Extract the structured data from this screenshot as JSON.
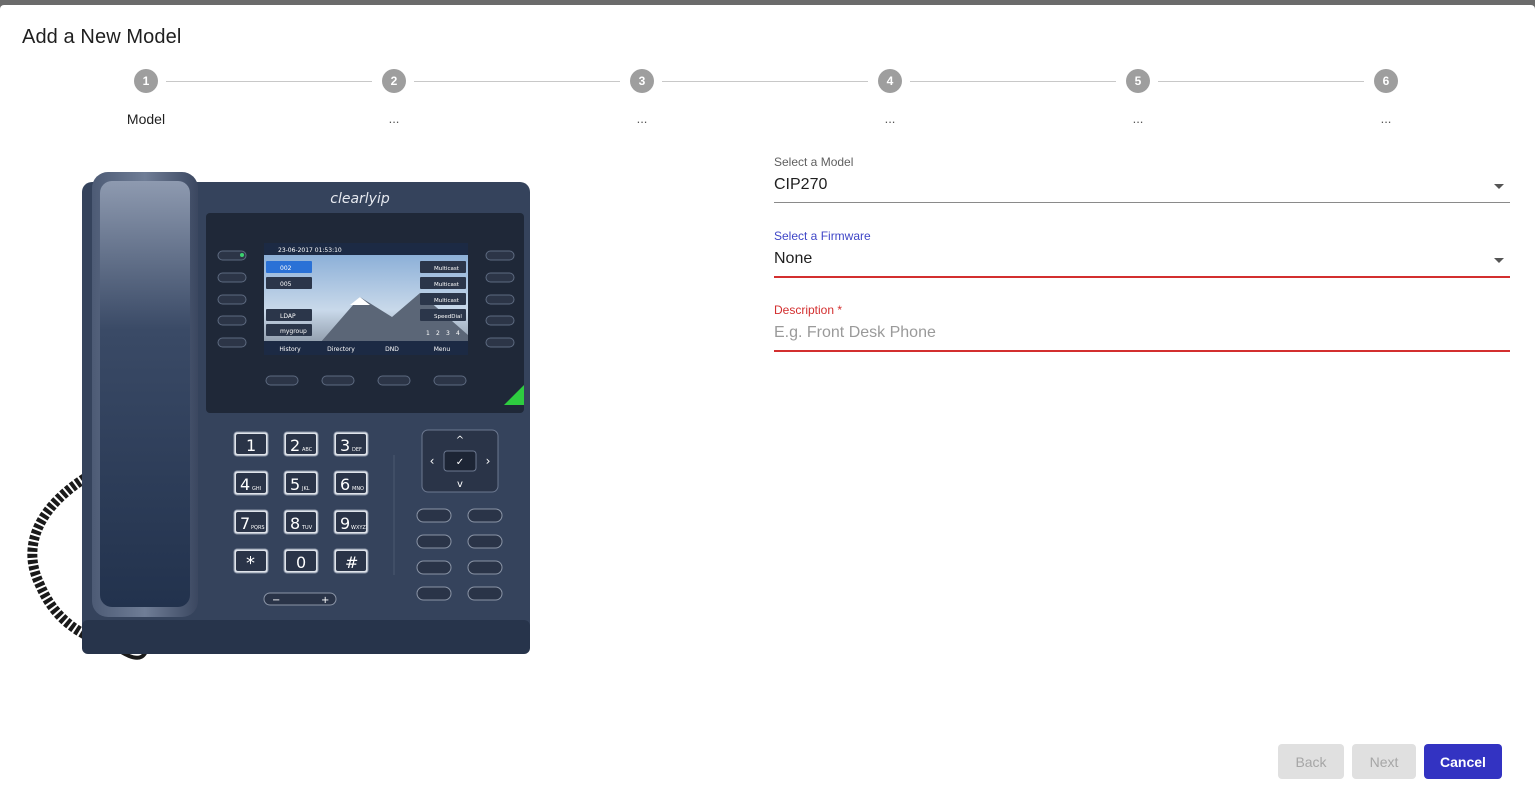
{
  "dialog": {
    "title": "Add a New Model"
  },
  "stepper": {
    "steps": [
      {
        "number": "1",
        "label": "Model"
      },
      {
        "number": "2",
        "label": "..."
      },
      {
        "number": "3",
        "label": "..."
      },
      {
        "number": "4",
        "label": "..."
      },
      {
        "number": "5",
        "label": "..."
      },
      {
        "number": "6",
        "label": "..."
      }
    ]
  },
  "form": {
    "model": {
      "label": "Select a Model",
      "value": "CIP270"
    },
    "firmware": {
      "label": "Select a Firmware",
      "value": "None"
    },
    "description": {
      "label": "Description",
      "required_mark": "*",
      "placeholder": "E.g. Front Desk Phone"
    }
  },
  "phone_image": {
    "brand": "clearlyip",
    "screen": {
      "datetime": "23-06-2017 01:53:10",
      "left_lines": [
        "002",
        "005",
        "LDAP",
        "mygroup"
      ],
      "right_lines": [
        "Multicast",
        "Multicast",
        "Multicast",
        "SpeedDial"
      ],
      "pages": [
        "1",
        "2",
        "3",
        "4"
      ],
      "softkeys": [
        "History",
        "Directory",
        "DND",
        "Menu"
      ]
    },
    "keypad": [
      {
        "digit": "1",
        "letters": ""
      },
      {
        "digit": "2",
        "letters": "ABC"
      },
      {
        "digit": "3",
        "letters": "DEF"
      },
      {
        "digit": "4",
        "letters": "GHI"
      },
      {
        "digit": "5",
        "letters": "JKL"
      },
      {
        "digit": "6",
        "letters": "MNO"
      },
      {
        "digit": "7",
        "letters": "PQRS"
      },
      {
        "digit": "8",
        "letters": "TUV"
      },
      {
        "digit": "9",
        "letters": "WXYZ"
      },
      {
        "digit": "*",
        "letters": ""
      },
      {
        "digit": "0",
        "letters": ""
      },
      {
        "digit": "#",
        "letters": ""
      }
    ],
    "volume": {
      "minus": "−",
      "plus": "+"
    }
  },
  "actions": {
    "back_label": "Back",
    "next_label": "Next",
    "cancel_label": "Cancel"
  },
  "colors": {
    "primary": "#3333c2",
    "error": "#d32f2f",
    "focus_label": "#3f46c7",
    "step": "#9e9e9e"
  }
}
